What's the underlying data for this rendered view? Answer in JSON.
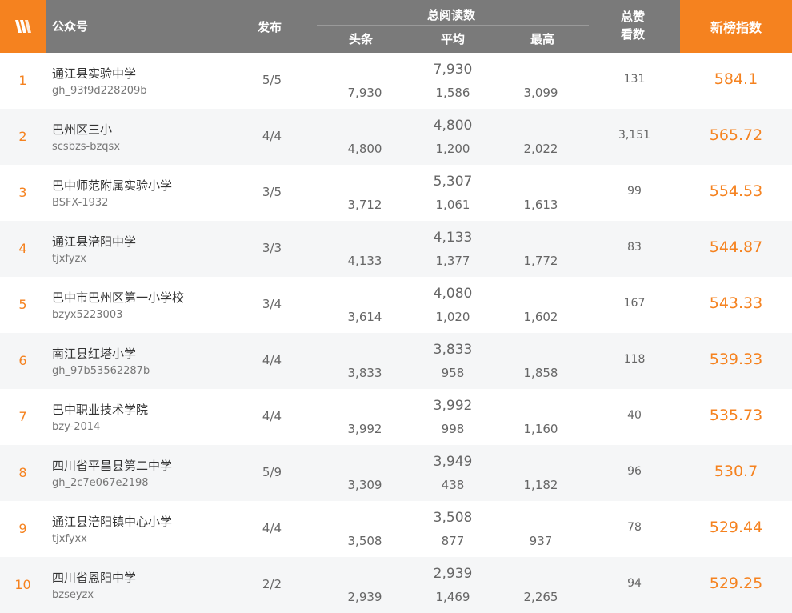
{
  "header": {
    "logo_icon": "wechat-w-logo-icon",
    "name": "公众号",
    "publish": "发布",
    "total_reads": "总阅读数",
    "head": "头条",
    "avg": "平均",
    "max": "最高",
    "likes_line1": "总赞",
    "likes_line2": "看数",
    "index": "新榜指数"
  },
  "colors": {
    "accent": "#f5821f",
    "header_bg": "#7a7a7a",
    "row_alt": "#f5f6f7"
  },
  "rows": [
    {
      "rank": "1",
      "name": "通江县实验中学",
      "account": "gh_93f9d228209b",
      "publish": "5/5",
      "total": "7,930",
      "head": "7,930",
      "avg": "1,586",
      "max": "3,099",
      "likes": "131",
      "index": "584.1"
    },
    {
      "rank": "2",
      "name": "巴州区三小",
      "account": "scsbzs-bzqsx",
      "publish": "4/4",
      "total": "4,800",
      "head": "4,800",
      "avg": "1,200",
      "max": "2,022",
      "likes": "3,151",
      "index": "565.72"
    },
    {
      "rank": "3",
      "name": "巴中师范附属实验小学",
      "account": "BSFX-1932",
      "publish": "3/5",
      "total": "5,307",
      "head": "3,712",
      "avg": "1,061",
      "max": "1,613",
      "likes": "99",
      "index": "554.53"
    },
    {
      "rank": "4",
      "name": "通江县涪阳中学",
      "account": "tjxfyzx",
      "publish": "3/3",
      "total": "4,133",
      "head": "4,133",
      "avg": "1,377",
      "max": "1,772",
      "likes": "83",
      "index": "544.87"
    },
    {
      "rank": "5",
      "name": "巴中市巴州区第一小学校",
      "account": "bzyx5223003",
      "publish": "3/4",
      "total": "4,080",
      "head": "3,614",
      "avg": "1,020",
      "max": "1,602",
      "likes": "167",
      "index": "543.33"
    },
    {
      "rank": "6",
      "name": "南江县红塔小学",
      "account": "gh_97b53562287b",
      "publish": "4/4",
      "total": "3,833",
      "head": "3,833",
      "avg": "958",
      "max": "1,858",
      "likes": "118",
      "index": "539.33"
    },
    {
      "rank": "7",
      "name": "巴中职业技术学院",
      "account": "bzy-2014",
      "publish": "4/4",
      "total": "3,992",
      "head": "3,992",
      "avg": "998",
      "max": "1,160",
      "likes": "40",
      "index": "535.73"
    },
    {
      "rank": "8",
      "name": "四川省平昌县第二中学",
      "account": "gh_2c7e067e2198",
      "publish": "5/9",
      "total": "3,949",
      "head": "3,309",
      "avg": "438",
      "max": "1,182",
      "likes": "96",
      "index": "530.7"
    },
    {
      "rank": "9",
      "name": "通江县涪阳镇中心小学",
      "account": "tjxfyxx",
      "publish": "4/4",
      "total": "3,508",
      "head": "3,508",
      "avg": "877",
      "max": "937",
      "likes": "78",
      "index": "529.44"
    },
    {
      "rank": "10",
      "name": "四川省恩阳中学",
      "account": "bzseyzx",
      "publish": "2/2",
      "total": "2,939",
      "head": "2,939",
      "avg": "1,469",
      "max": "2,265",
      "likes": "94",
      "index": "529.25"
    }
  ]
}
